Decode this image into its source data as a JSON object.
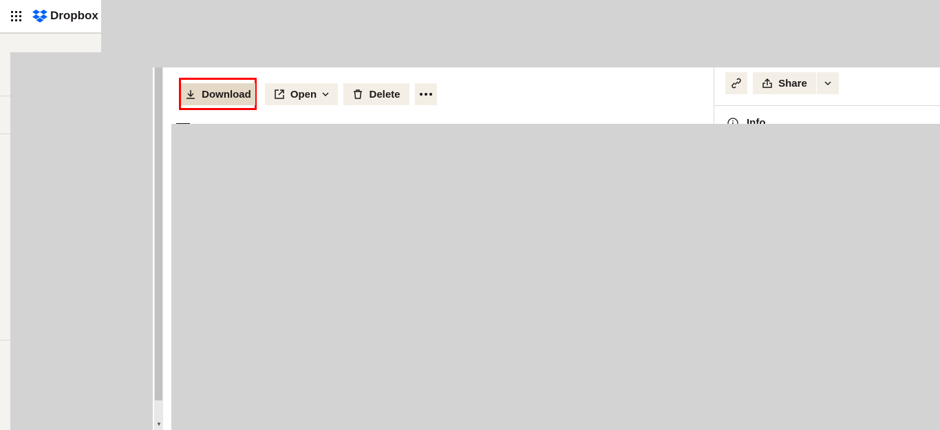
{
  "header": {
    "brand": "Dropbox",
    "brand_color": "#0061fe",
    "apps_icon": "grid-icon"
  },
  "toolbar": {
    "download": "Download",
    "open": "Open",
    "delete": "Delete",
    "more_icon": "ellipsis-icon",
    "highlight_color": "#ff0000"
  },
  "right_panel": {
    "share": "Share",
    "link_icon": "link-icon",
    "info": "Info"
  }
}
